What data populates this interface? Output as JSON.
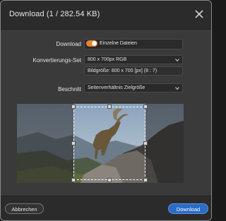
{
  "window": {
    "title": "Download (1 / 282.54 KB)"
  },
  "form": {
    "download_label": "Download",
    "download_toggle_text": "Einzelne Dateien",
    "conversion_label": "Konvertierungs-Set",
    "conversion_value": "800 x 700px RGB",
    "image_size_text": "Bildgröße: 800 x 700 [px] (8 : 7)",
    "crop_label": "Beschnitt",
    "crop_value": "Seitenverhältnis Zielgröße"
  },
  "footer": {
    "cancel_label": "Abbrechen",
    "download_label": "Download"
  },
  "colors": {
    "accent_toggle": "#e8832a",
    "primary_button": "#2b6cc4"
  },
  "icons": {
    "close": "close-icon",
    "chevron": "chevron-down-icon"
  }
}
